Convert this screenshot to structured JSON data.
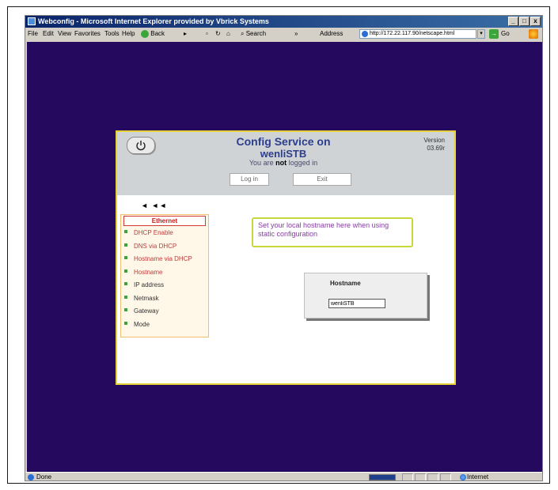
{
  "window": {
    "title": "Webconfig - Microsoft Internet Explorer provided by Vbrick Systems",
    "buttons": {
      "minimize": "_",
      "maximize": "□",
      "close": "x"
    }
  },
  "menubar": {
    "items": [
      "File",
      "Edit",
      "View",
      "Favorites",
      "Tools",
      "Help"
    ],
    "back": "Back",
    "search": "Search",
    "address_label": "Address",
    "address_value": "http://172.22.117.90/netscape.html",
    "go": "Go"
  },
  "config": {
    "title": "Config Service on",
    "hostname": "wenliSTB",
    "login_prefix": "You are ",
    "login_bold": "not",
    "login_suffix": " logged in",
    "version_label": "Version",
    "version_value": "03.69r",
    "login_button": "Log in",
    "exit_button": "Exit"
  },
  "nav": {
    "back_arrows": "◄ ◄◄",
    "section_title": "Ethernet",
    "items": [
      {
        "label": "DHCP Enable",
        "style": "red"
      },
      {
        "label": "DNS via DHCP",
        "style": "red"
      },
      {
        "label": "Hostname via DHCP",
        "style": "red"
      },
      {
        "label": "Hostname",
        "style": "red"
      },
      {
        "label": "IP address",
        "style": "dark"
      },
      {
        "label": "Netmask",
        "style": "dark"
      },
      {
        "label": "Gateway",
        "style": "dark"
      },
      {
        "label": "Mode",
        "style": "dark"
      }
    ]
  },
  "help": {
    "text": "Set your local hostname here when using static configuration"
  },
  "hostname_form": {
    "label": "Hostname",
    "value": "wenliSTB"
  },
  "statusbar": {
    "status": "Done",
    "zone": "Internet"
  }
}
